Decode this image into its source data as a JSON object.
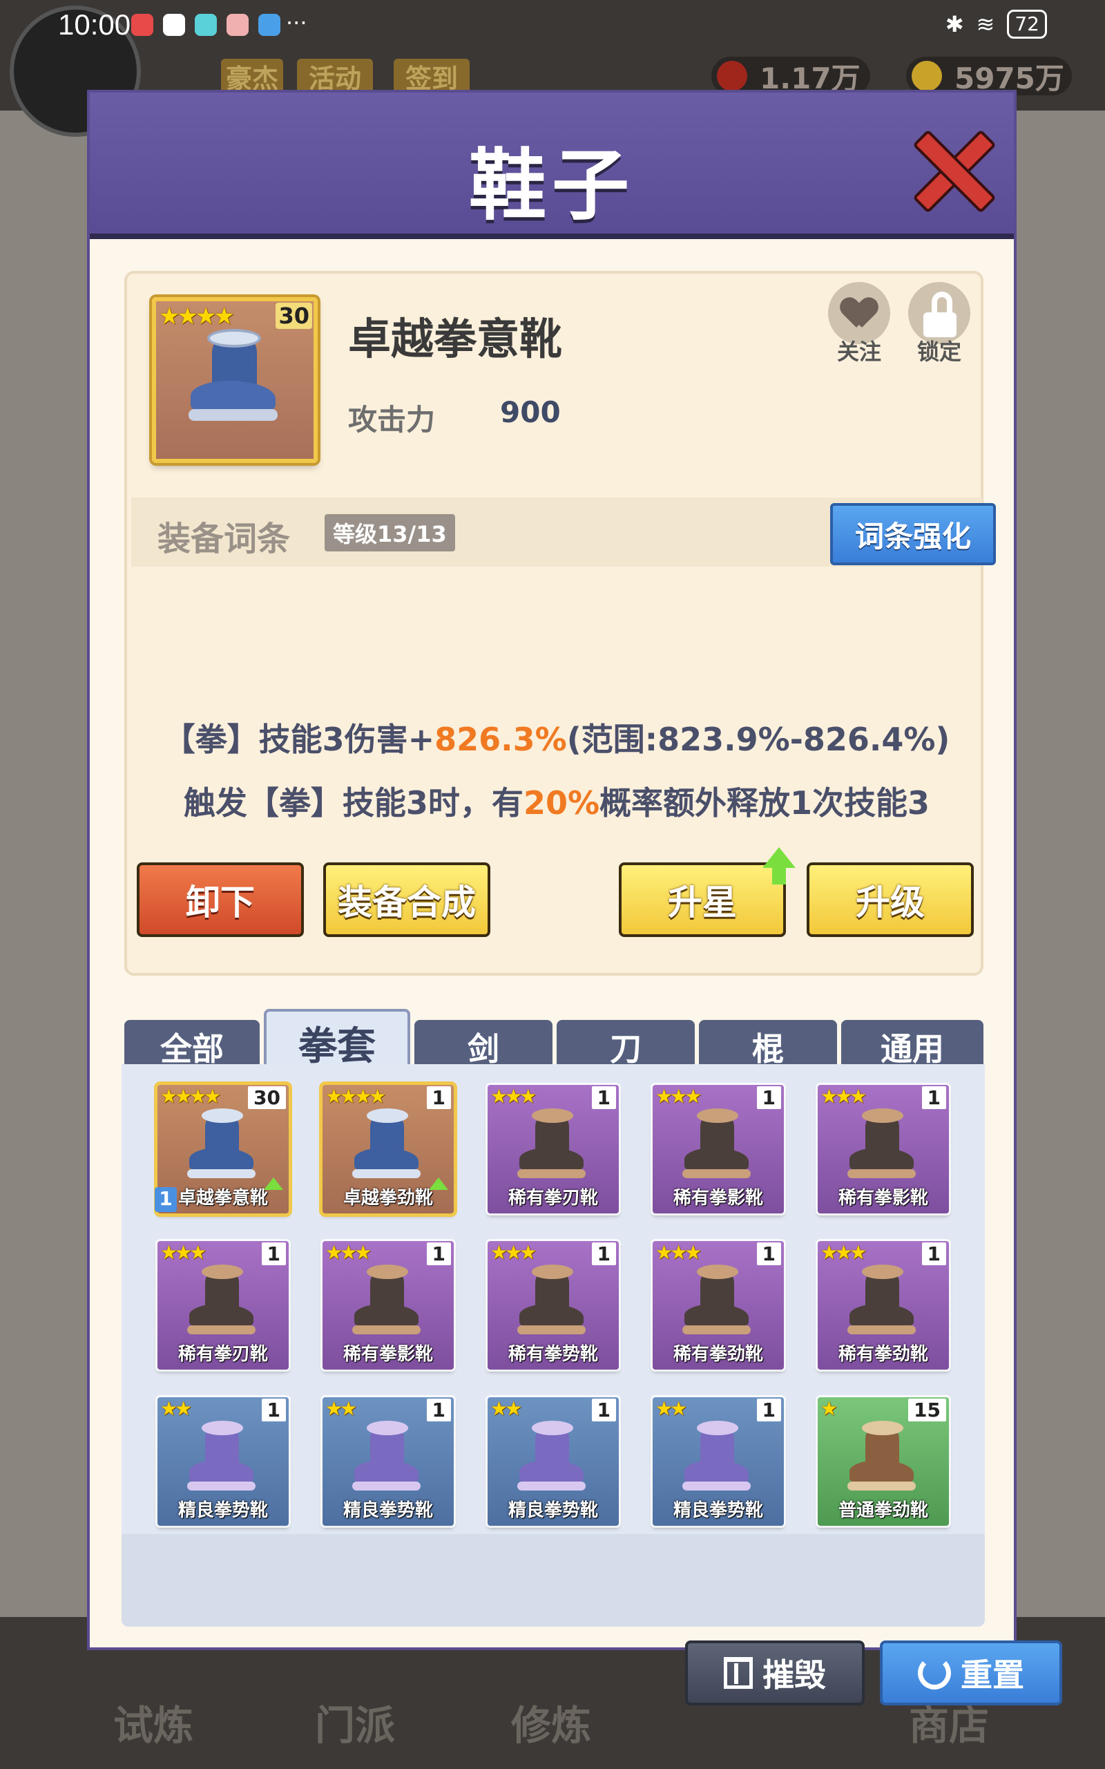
{
  "status_bar": {
    "time": "10:00",
    "battery": "72"
  },
  "background": {
    "top_pills": [
      "豪杰",
      "活动",
      "签到"
    ],
    "resources": [
      "1.17万",
      "5975万"
    ],
    "bottom_nav": [
      "试炼",
      "门派",
      "修炼",
      "商店"
    ]
  },
  "modal": {
    "title": "鞋子"
  },
  "item": {
    "stars": "★★★★",
    "level": "30",
    "name": "卓越拳意靴",
    "attr_label": "攻击力",
    "attr_value": "900",
    "follow_label": "关注",
    "lock_label": "锁定"
  },
  "affix": {
    "title": "装备词条",
    "level": "等级13/13",
    "enhance_label": "词条强化",
    "line1_pre": "【拳】技能3伤害+",
    "line1_hl": "826.3%",
    "line1_post": "(范围:823.9%-826.4%)",
    "line2_pre": "触发【拳】技能3时，有",
    "line2_hl": "20%",
    "line2_post": "概率额外释放1次技能3"
  },
  "actions": {
    "unequip": "卸下",
    "synthesize": "装备合成",
    "star_up": "升星",
    "upgrade": "升级"
  },
  "tabs": [
    "全部",
    "拳套",
    "剑",
    "刀",
    "棍",
    "通用"
  ],
  "active_tab": "拳套",
  "inventory": [
    {
      "name": "卓越拳意靴",
      "stars": "★★★★",
      "count": "30",
      "rarity": "legend",
      "equipped": "1",
      "upgradable": true
    },
    {
      "name": "卓越拳劲靴",
      "stars": "★★★★",
      "count": "1",
      "rarity": "legend",
      "upgradable": true
    },
    {
      "name": "稀有拳刃靴",
      "stars": "★★★",
      "count": "1",
      "rarity": "rare"
    },
    {
      "name": "稀有拳影靴",
      "stars": "★★★",
      "count": "1",
      "rarity": "rare"
    },
    {
      "name": "稀有拳影靴",
      "stars": "★★★",
      "count": "1",
      "rarity": "rare"
    },
    {
      "name": "稀有拳刃靴",
      "stars": "★★★",
      "count": "1",
      "rarity": "rare"
    },
    {
      "name": "稀有拳影靴",
      "stars": "★★★",
      "count": "1",
      "rarity": "rare"
    },
    {
      "name": "稀有拳势靴",
      "stars": "★★★",
      "count": "1",
      "rarity": "rare"
    },
    {
      "name": "稀有拳劲靴",
      "stars": "★★★",
      "count": "1",
      "rarity": "rare"
    },
    {
      "name": "稀有拳劲靴",
      "stars": "★★★",
      "count": "1",
      "rarity": "rare"
    },
    {
      "name": "精良拳势靴",
      "stars": "★★",
      "count": "1",
      "rarity": "fine"
    },
    {
      "name": "精良拳势靴",
      "stars": "★★",
      "count": "1",
      "rarity": "fine"
    },
    {
      "name": "精良拳势靴",
      "stars": "★★",
      "count": "1",
      "rarity": "fine"
    },
    {
      "name": "精良拳势靴",
      "stars": "★★",
      "count": "1",
      "rarity": "fine"
    },
    {
      "name": "普通拳劲靴",
      "stars": "★",
      "count": "15",
      "rarity": "common"
    }
  ],
  "bottom_buttons": {
    "destroy": "摧毁",
    "reset": "重置"
  },
  "colors": {
    "header": "#5a4c94",
    "highlight": "#f07a22",
    "blue_button": "#3a7ed8",
    "legend_border": "#f1c84a"
  }
}
